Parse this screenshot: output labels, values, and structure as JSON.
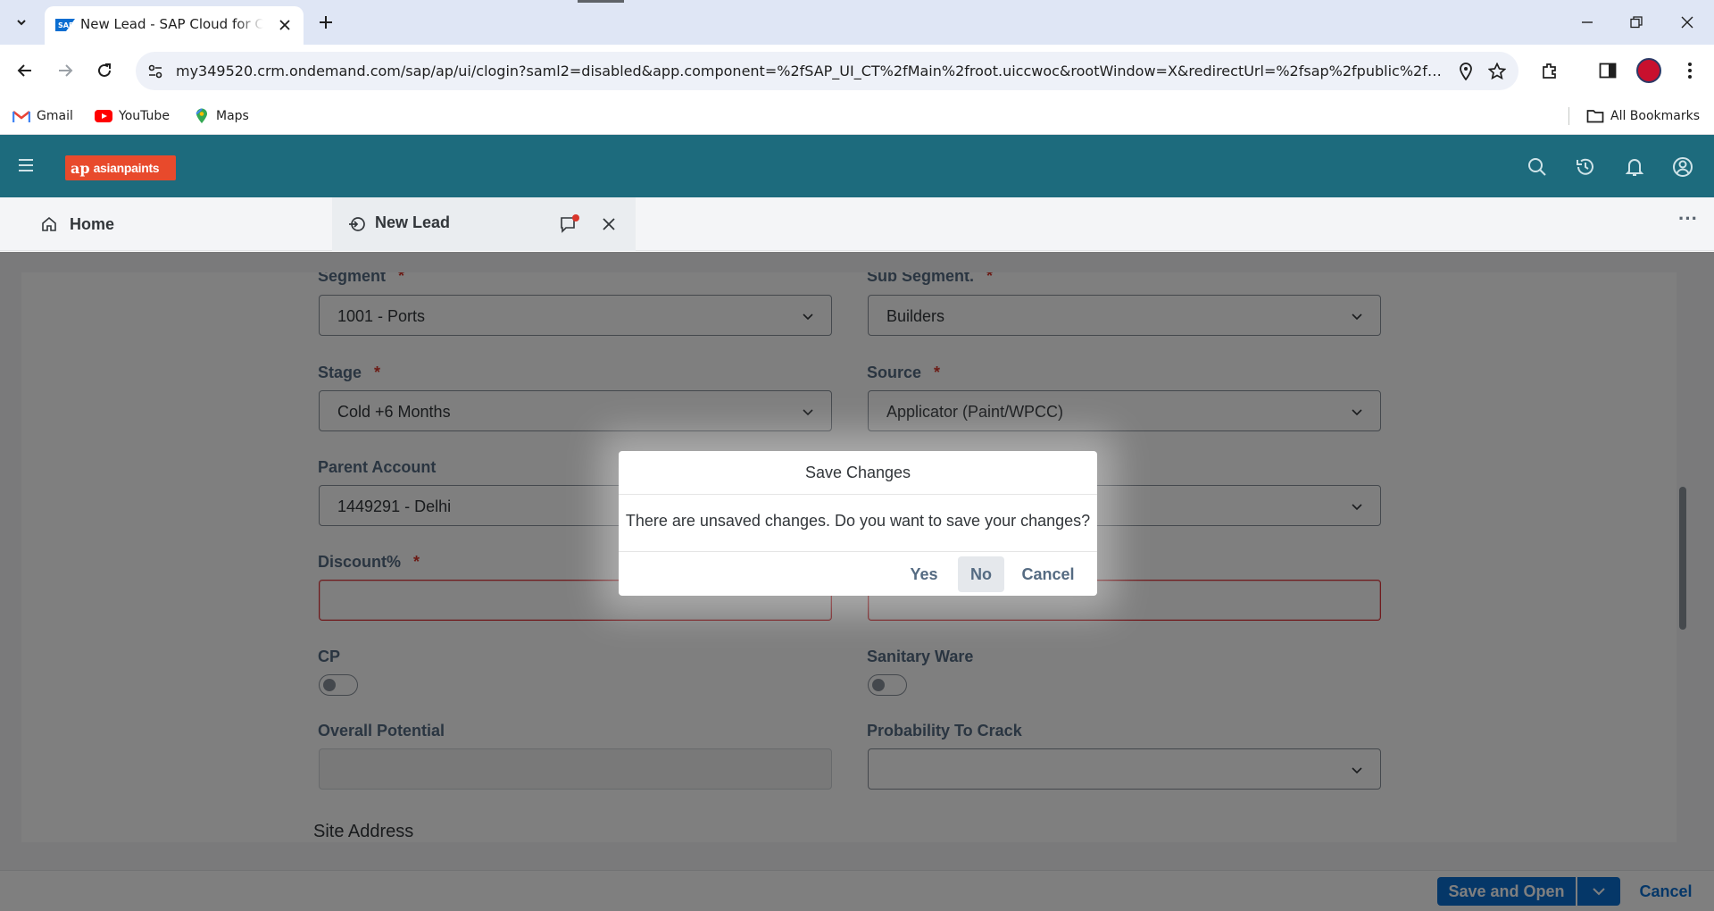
{
  "browser": {
    "tab_title": "New Lead - SAP Cloud for Customer",
    "url": "my349520.crm.ondemand.com/sap/ap/ui/clogin?saml2=disabled&app.component=%2fSAP_UI_CT%2fMain%2froot.uiccwoc&rootWindow=X&redirectUrl=%2fsap%2fpublic%2fbyd%...",
    "bookmarks": [
      {
        "label": "Gmail",
        "icon": "gmail-icon"
      },
      {
        "label": "YouTube",
        "icon": "youtube-icon"
      },
      {
        "label": "Maps",
        "icon": "maps-icon"
      }
    ],
    "all_bookmarks": "All Bookmarks"
  },
  "app": {
    "brand": "asianpaints",
    "brand_mark": "ap",
    "tabs": {
      "home": "Home",
      "active": "New Lead"
    },
    "overflow": "···"
  },
  "form": {
    "segment": {
      "label": "Segment",
      "value": "1001 - Ports"
    },
    "sub_segment": {
      "label": "Sub Segment.",
      "value": "Builders"
    },
    "stage": {
      "label": "Stage",
      "value": "Cold +6 Months"
    },
    "source": {
      "label": "Source",
      "value": "Applicator (Paint/WPCC)"
    },
    "parent_account": {
      "label": "Parent Account",
      "value": "1449291 - Delhi"
    },
    "discount": {
      "label": "Discount%",
      "value": ""
    },
    "cp": {
      "label": "CP"
    },
    "sanitary_ware": {
      "label": "Sanitary Ware"
    },
    "overall_potential": {
      "label": "Overall Potential",
      "value": ""
    },
    "probability": {
      "label": "Probability To Crack",
      "value": ""
    },
    "site_address": "Site Address",
    "required_marker": "*"
  },
  "footer": {
    "save_and_open": "Save and Open",
    "cancel": "Cancel"
  },
  "dialog": {
    "title": "Save Changes",
    "message": "There are unsaved changes. Do you want to save your changes?",
    "yes": "Yes",
    "no": "No",
    "cancel": "Cancel"
  },
  "colors": {
    "shell": "#1d6b7d",
    "brand": "#e84a2c",
    "primary_button": "#0a6ed1",
    "error": "#e0353b",
    "label": "#556b82"
  }
}
